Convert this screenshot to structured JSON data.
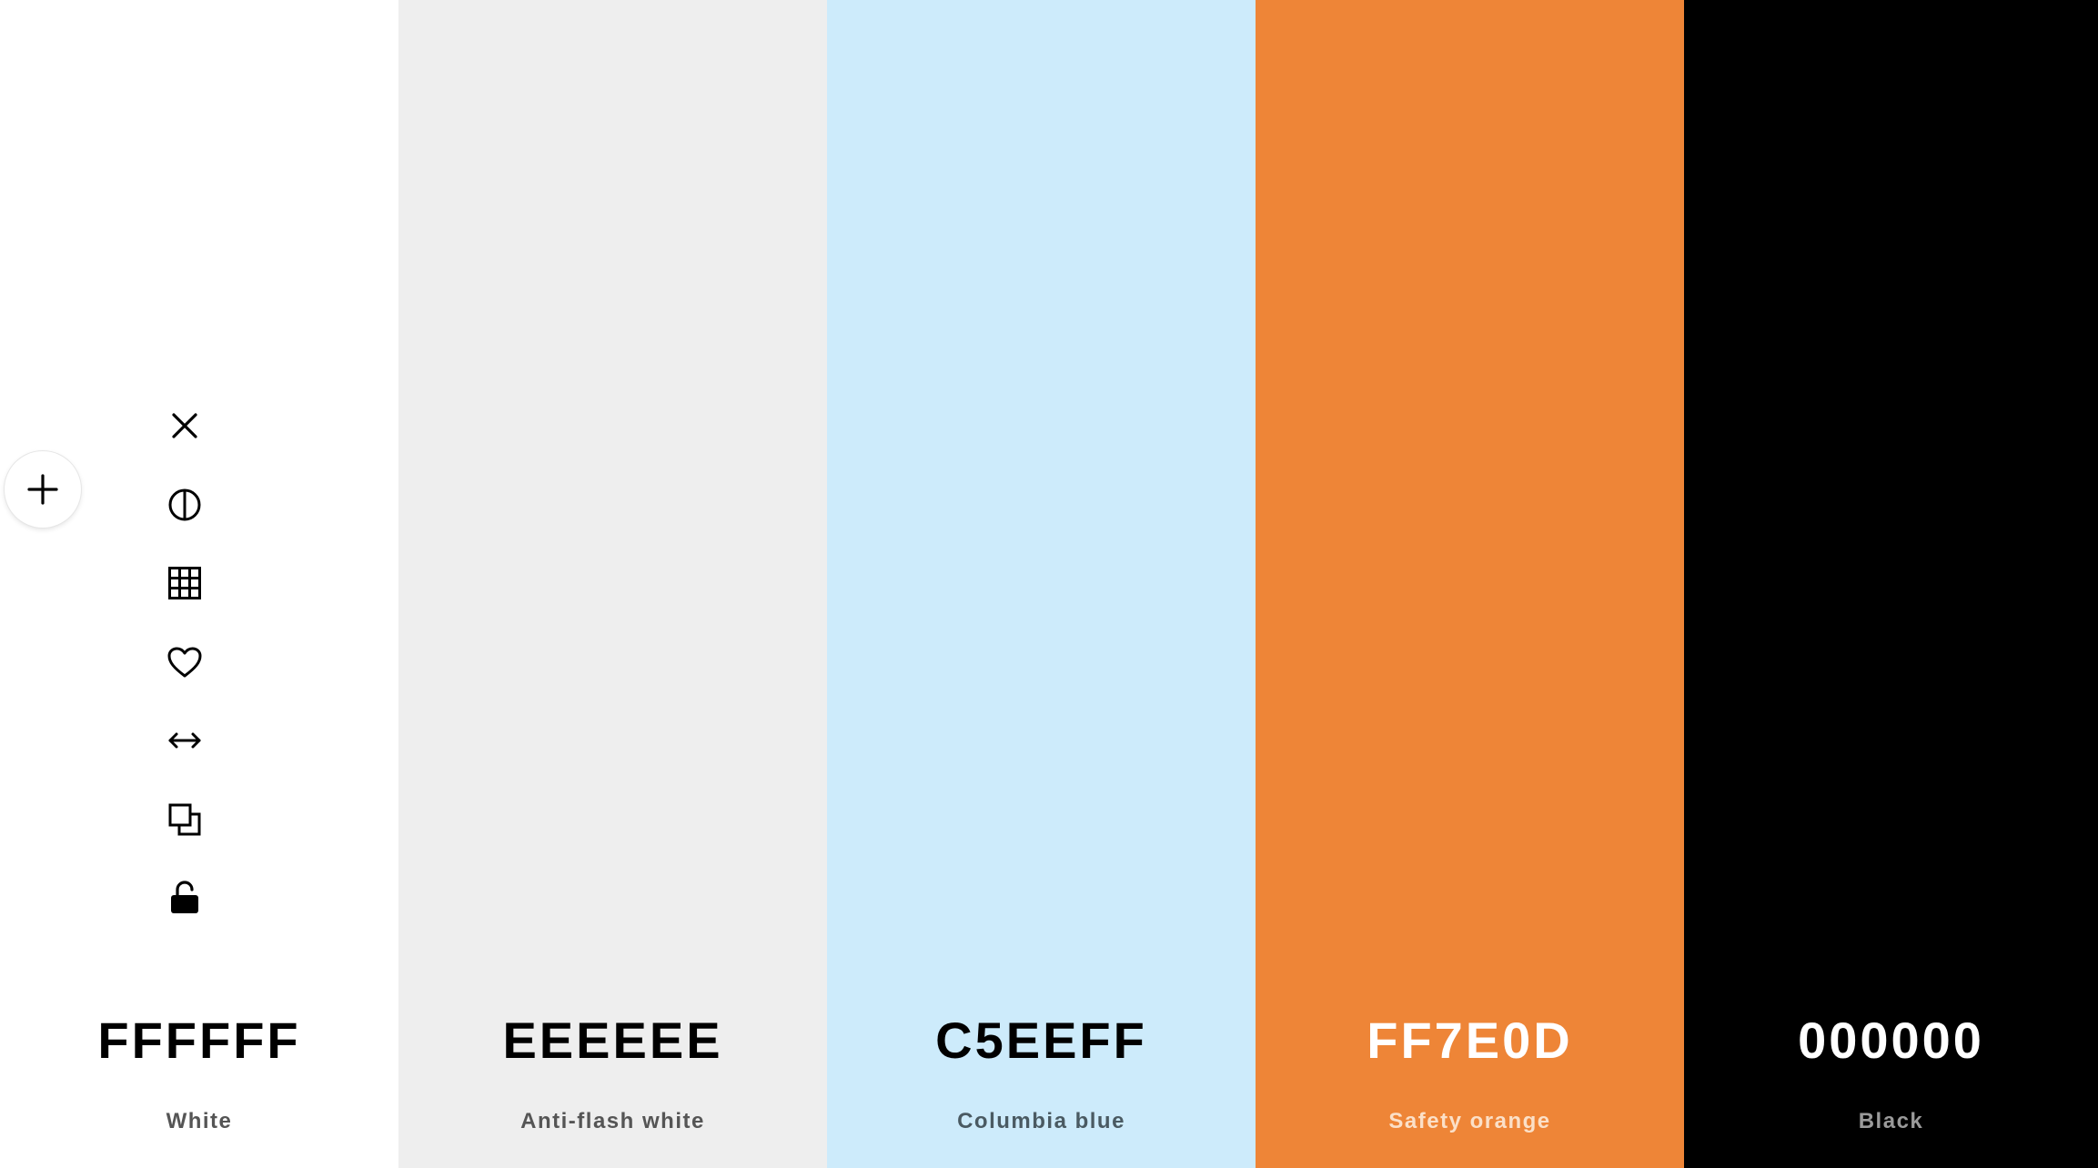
{
  "palette": [
    {
      "hex": "FFFFFF",
      "name": "White",
      "bg": "#ffffff",
      "text_color": "#000000",
      "name_color": "#555555"
    },
    {
      "hex": "EEEEEE",
      "name": "Anti-flash white",
      "bg": "#eeeeee",
      "text_color": "#000000",
      "name_color": "#555555"
    },
    {
      "hex": "C5EEFF",
      "name": "Columbia blue",
      "bg": "#cdebfb",
      "text_color": "#000000",
      "name_color": "#4a5a62"
    },
    {
      "hex": "FF7E0D",
      "name": "Safety orange",
      "bg": "#ee8537",
      "text_color": "#ffffff",
      "name_color": "#fbe0c8"
    },
    {
      "hex": "000000",
      "name": "Black",
      "bg": "#000000",
      "text_color": "#ffffff",
      "name_color": "#9a9a9a"
    }
  ],
  "toolbar": {
    "tools": [
      "close-icon",
      "contrast-icon",
      "grid-icon",
      "heart-icon",
      "arrows-horizontal-icon",
      "copy-icon",
      "unlock-icon"
    ]
  },
  "add_button": {
    "icon": "plus-icon"
  }
}
